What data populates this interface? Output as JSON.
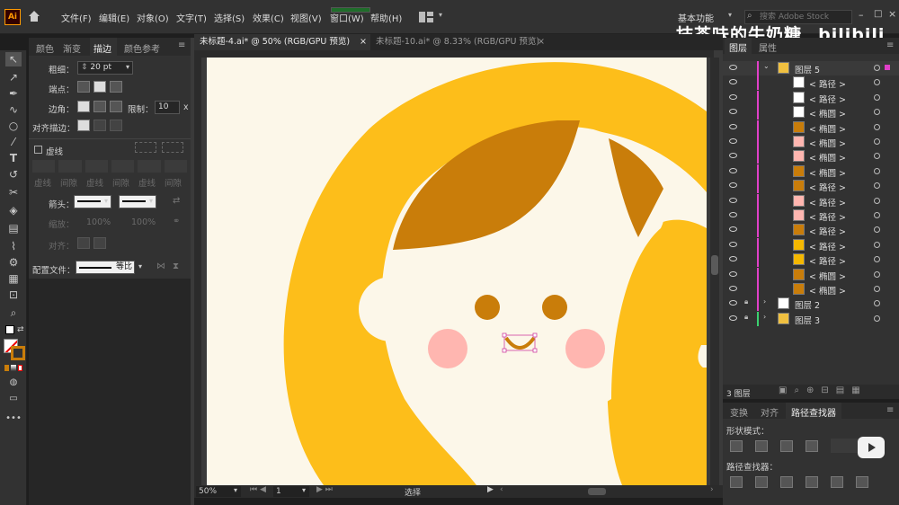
{
  "app": {
    "logo": "Ai"
  },
  "menu": [
    "文件(F)",
    "编辑(E)",
    "对象(O)",
    "文字(T)",
    "选择(S)",
    "效果(C)",
    "视图(V)",
    "窗口(W)",
    "帮助(H)"
  ],
  "workspace": "基本功能",
  "search_placeholder": "搜索 Adobe Stock",
  "brand": "抹茶味的牛奶糖_ bilibili",
  "tabs": [
    {
      "label": "未标题-4.ai* @ 50% (RGB/GPU 预览)",
      "close": "×"
    },
    {
      "label": "未标题-10.ai* @ 8.33% (RGB/GPU 预览)",
      "close": "×"
    }
  ],
  "stroke_panel": {
    "tabs": [
      "颜色",
      "渐变",
      "描边",
      "颜色参考"
    ],
    "weight_label": "粗细：",
    "weight_value": "20 pt",
    "cap_label": "端点：",
    "corner_label": "边角：",
    "limit_label": "限制：",
    "limit_value": "10",
    "limit_unit": "x",
    "align_label": "对齐描边：",
    "dashed_label": "虚线",
    "dash_labels": [
      "虚线",
      "间隙",
      "虚线",
      "间隙",
      "虚线",
      "间隙"
    ],
    "arrow_label": "箭头：",
    "scale_label": "缩放：",
    "scale_values": [
      "100%",
      "100%"
    ],
    "align2_label": "对齐：",
    "profile_label": "配置文件：",
    "profile_value": "等比"
  },
  "status": {
    "zoom": "50%",
    "artboard": "1",
    "tool": "选择"
  },
  "layers_panel": {
    "tabs": [
      "图层",
      "属性"
    ],
    "rows": [
      {
        "name": "图层 5",
        "type": "layer",
        "thumb": "#f0c040"
      },
      {
        "name": "< 路径 >",
        "type": "item",
        "thumb": "#ffffff"
      },
      {
        "name": "< 路径 >",
        "type": "item",
        "thumb": "#ffffff"
      },
      {
        "name": "< 椭圆 >",
        "type": "item",
        "thumb": "#ffffff"
      },
      {
        "name": "< 椭圆 >",
        "type": "item",
        "thumb": "#c97d0a"
      },
      {
        "name": "< 椭圆 >",
        "type": "item",
        "thumb": "#ffb6b0"
      },
      {
        "name": "< 椭圆 >",
        "type": "item",
        "thumb": "#ffb6b0"
      },
      {
        "name": "< 椭圆 >",
        "type": "item",
        "thumb": "#c97d0a"
      },
      {
        "name": "< 路径 >",
        "type": "item",
        "thumb": "#c97d0a"
      },
      {
        "name": "< 路径 >",
        "type": "item",
        "thumb": "#ffb6b0"
      },
      {
        "name": "< 路径 >",
        "type": "item",
        "thumb": "#ffb6b0"
      },
      {
        "name": "< 路径 >",
        "type": "item",
        "thumb": "#c97d0a"
      },
      {
        "name": "< 路径 >",
        "type": "item",
        "thumb": "#f5b800"
      },
      {
        "name": "< 路径 >",
        "type": "item",
        "thumb": "#f5b800"
      },
      {
        "name": "< 椭圆 >",
        "type": "item",
        "thumb": "#c97d0a"
      },
      {
        "name": "< 椭圆 >",
        "type": "item",
        "thumb": "#c97d0a"
      },
      {
        "name": "图层 2",
        "type": "layer",
        "thumb": "#ffffff"
      },
      {
        "name": "图层 3",
        "type": "layer",
        "thumb": "#f0c040"
      }
    ],
    "footer": "3 图层"
  },
  "pathfinder": {
    "tabs": [
      "变换",
      "对齐",
      "路径查找器"
    ],
    "shape_modes": "形状模式：",
    "pathfinders": "路径查找器："
  },
  "colors": {
    "hair": "#fdbe1a",
    "bangs": "#c97d0a",
    "face": "#fcf7e9",
    "blush": "#ffb6b0",
    "eyes": "#c97d0a"
  }
}
